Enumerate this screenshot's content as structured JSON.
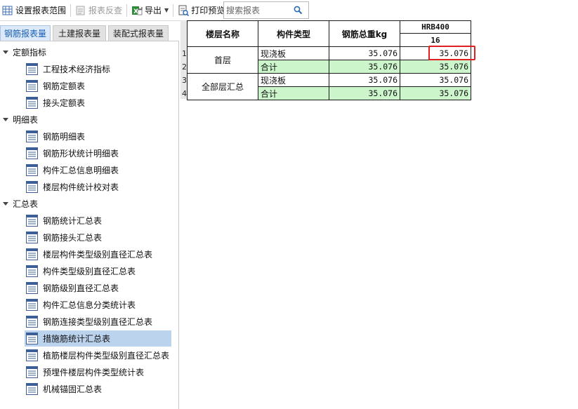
{
  "toolbar": {
    "set_range": "设置报表范围",
    "reverse_check": "报表反查",
    "export": "导出",
    "print_preview": "打印预览",
    "search_placeholder": "搜索报表"
  },
  "tabs": [
    {
      "label": "钢筋报表量",
      "active": true
    },
    {
      "label": "土建报表量",
      "active": false
    },
    {
      "label": "装配式报表量",
      "active": false
    }
  ],
  "tree": {
    "groups": [
      {
        "label": "定额指标",
        "items": [
          "工程技术经济指标",
          "钢筋定额表",
          "接头定额表"
        ]
      },
      {
        "label": "明细表",
        "items": [
          "钢筋明细表",
          "钢筋形状统计明细表",
          "构件汇总信息明细表",
          "楼层构件统计校对表"
        ]
      },
      {
        "label": "汇总表",
        "items": [
          "钢筋统计汇总表",
          "钢筋接头汇总表",
          "楼层构件类型级别直径汇总表",
          "构件类型级别直径汇总表",
          "钢筋级别直径汇总表",
          "构件汇总信息分类统计表",
          "钢筋连接类型级别直径汇总表",
          "措施筋统计汇总表",
          "植筋楼层构件类型级别直径汇总表",
          "预埋件楼层构件类型统计表",
          "机械锚固汇总表"
        ]
      }
    ],
    "selected": "措施筋统计汇总表"
  },
  "report": {
    "headers": {
      "floor": "楼层名称",
      "component": "构件类型",
      "total_weight": "钢筋总重kg",
      "grade": "HRB400",
      "diameter": "16"
    },
    "row_numbers": [
      "1",
      "2",
      "3",
      "4"
    ],
    "rows": [
      {
        "floor": "首层",
        "component": "现浇板",
        "total": "35.076",
        "d16": "35.076"
      },
      {
        "floor": "",
        "component": "合计",
        "total": "35.076",
        "d16": "35.076"
      },
      {
        "floor": "全部层汇总",
        "component": "现浇板",
        "total": "35.076",
        "d16": "35.076"
      },
      {
        "floor": "",
        "component": "合计",
        "total": "35.076",
        "d16": "35.076"
      }
    ]
  },
  "colors": {
    "total_row_bg": "#ccf5cc",
    "selected_item_bg": "#bcd3ee",
    "highlight_border": "#e02020",
    "active_tab_text": "#1a5fb4"
  }
}
